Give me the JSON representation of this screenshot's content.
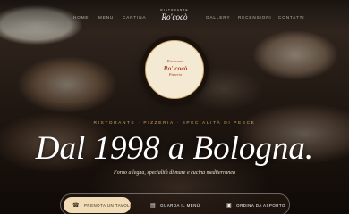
{
  "nav": {
    "left": [
      "HOME",
      "MENU",
      "CANTINA"
    ],
    "right": [
      "GALLERY",
      "RECENSIONI",
      "CONTATTI"
    ]
  },
  "brand": {
    "kicker": "RISTORANTE",
    "name": "Ro'cocò"
  },
  "logo": {
    "line1": "Ristorante",
    "line2": "Ro' cocò",
    "line3": "Pizzeria"
  },
  "hero": {
    "tagline": "RISTORANTE · PIZZERIA · SPECIALITÀ DI PESCE",
    "headline": "Dal 1998 a Bologna.",
    "subtext": "Forno a legna, specialità di mare e cucina mediterranea"
  },
  "cta": {
    "primary": "PRENOTA UN TAVOLO",
    "menu": "GUARDA IL MENÙ",
    "order": "ORDINA DA ASPORTO"
  },
  "colors": {
    "accent": "#c9a36a",
    "cta_bg": "#f1dcb7"
  },
  "icons": {
    "phone": "phone-icon",
    "menu": "menu-book-icon",
    "bag": "shopping-bag-icon"
  }
}
